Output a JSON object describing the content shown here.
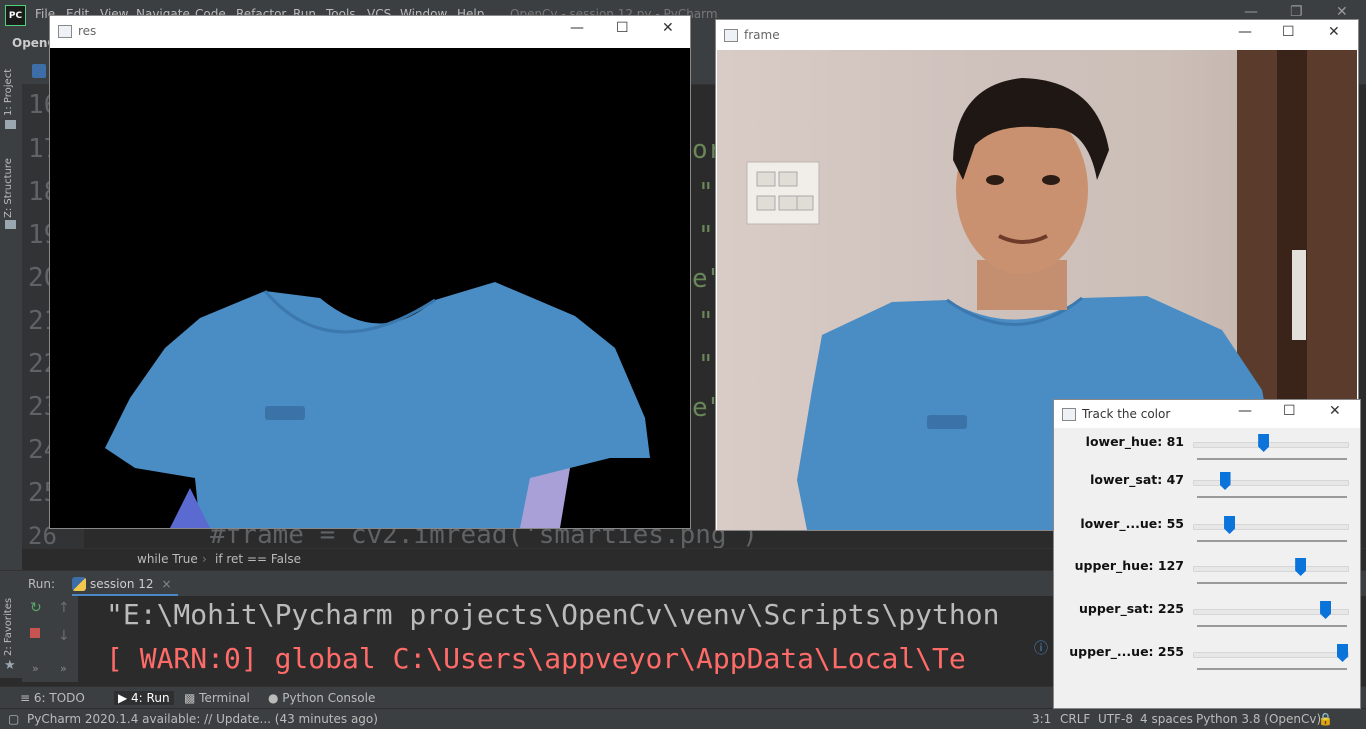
{
  "ide": {
    "logo": "PC",
    "menus": [
      "File",
      "Edit",
      "View",
      "Navigate",
      "Code",
      "Refactor",
      "Run",
      "Tools",
      "VCS",
      "Window",
      "Help"
    ],
    "title": "OpenCv - session 12.py - PyCharm",
    "project_crumb": "OpenC",
    "left_tabs": [
      "1: Project",
      "Z: Structure",
      "2: Favorites"
    ],
    "line_numbers": [
      "16",
      "17",
      "18",
      "19",
      "20",
      "21",
      "22",
      "23",
      "24",
      "25",
      "26"
    ],
    "visible_code_fragments": [
      "or",
      "\"",
      "\"",
      "e\"",
      "\"",
      "\"",
      "e\""
    ],
    "code_bottom_line": "#frame = cv2.imread('smarties.png')",
    "breadcrumbs": [
      "while True",
      "if ret == False"
    ],
    "run": {
      "label": "Run:",
      "tab": "session 12",
      "console_lines": [
        {
          "text": "\"E:\\Mohit\\Pycharm projects\\OpenCv\\venv\\Scripts\\python",
          "color": "#bbbbbb"
        },
        {
          "text": "[ WARN:0] global C:\\Users\\appveyor\\AppData\\Local\\Te",
          "color": "#ff6b68"
        }
      ]
    },
    "bottom_tabs": [
      "6: TODO",
      "4: Run",
      "Terminal",
      "Python Console"
    ],
    "status": {
      "message": "PyCharm 2020.1.4 available: // Update... (43 minutes ago)",
      "position": "3:1",
      "line_sep": "CRLF",
      "encoding": "UTF-8",
      "indent": "4 spaces",
      "interpreter": "Python 3.8 (OpenCv)"
    }
  },
  "windows": {
    "res": {
      "title": "res"
    },
    "frame": {
      "title": "frame"
    },
    "trackbars": {
      "title": "Track the color",
      "sliders": [
        {
          "label": "lower_hue: 81",
          "value": 81,
          "max": 179
        },
        {
          "label": "lower_sat: 47",
          "value": 47,
          "max": 255
        },
        {
          "label": "lower_...ue: 55",
          "value": 55,
          "max": 255
        },
        {
          "label": "upper_hue: 127",
          "value": 127,
          "max": 179
        },
        {
          "label": "upper_sat: 225",
          "value": 225,
          "max": 255
        },
        {
          "label": "upper_...ue: 255",
          "value": 255,
          "max": 255
        }
      ]
    }
  },
  "colors": {
    "shirt": "#4a8cc4",
    "thumb": "#0a74da",
    "warn": "#ff6b68"
  }
}
